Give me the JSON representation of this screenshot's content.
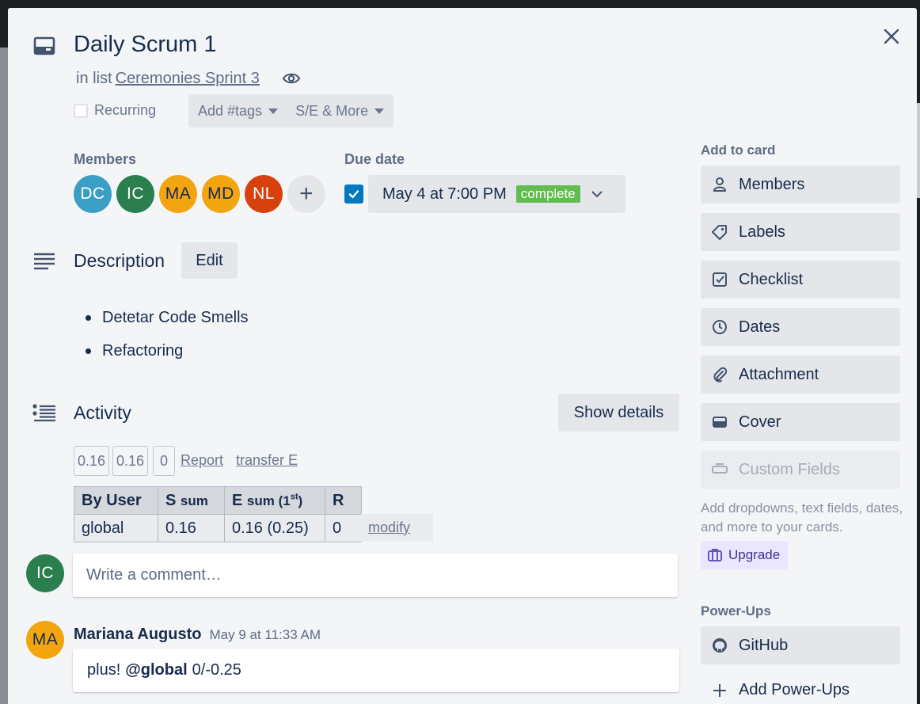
{
  "card": {
    "title": "Daily Scrum 1",
    "in_list_prefix": "in list",
    "list_name": "Ceremonies Sprint 3",
    "recurring_label": "Recurring",
    "tags_label": "Add #tags",
    "se_more_label": "S/E & More"
  },
  "members": {
    "label": "Members",
    "avatars": [
      {
        "initials": "DC",
        "color": "#3a9fc5"
      },
      {
        "initials": "IC",
        "color": "#2b7f4f"
      },
      {
        "initials": "MA",
        "color": "#f2a50f"
      },
      {
        "initials": "MD",
        "color": "#f2a50f"
      },
      {
        "initials": "NL",
        "color": "#d6410d"
      }
    ],
    "add_symbol": "+"
  },
  "due_date": {
    "label": "Due date",
    "value": "May 4 at 7:00 PM",
    "status": "complete",
    "checked": true
  },
  "description": {
    "title": "Description",
    "edit_label": "Edit",
    "items": [
      "Detetar Code Smells",
      "Refactoring"
    ]
  },
  "activity": {
    "title": "Activity",
    "show_details_label": "Show details",
    "mini_values": [
      "0.16",
      "0.16",
      "0"
    ],
    "report_label": "Report",
    "transfer_label": "transfer E",
    "table": {
      "headers": [
        "By User",
        "S",
        "sum",
        "E",
        "sum (1",
        "st",
        ")",
        "R"
      ],
      "row": [
        "global",
        "0.16",
        "0.16 (0.25)",
        "0"
      ]
    },
    "modify_label": "modify",
    "comment_placeholder": "Write a comment…",
    "current_user_initials": "IC",
    "comment": {
      "author_initials": "MA",
      "author": "Mariana Augusto",
      "time": "May 9 at 11:33 AM",
      "text_before": "plus!",
      "mention": "@global",
      "text_after": "0/-0.25"
    }
  },
  "sidebar": {
    "add_to_card_title": "Add to card",
    "buttons": [
      "Members",
      "Labels",
      "Checklist",
      "Dates",
      "Attachment",
      "Cover",
      "Custom Fields"
    ],
    "custom_fields_note": "Add dropdowns, text fields, dates, and more to your cards.",
    "upgrade_label": "Upgrade",
    "powerups_title": "Power-Ups",
    "github_label": "GitHub",
    "add_powerups_label": "Add Power-Ups"
  },
  "colors": {
    "accent_blue": "#0079bf",
    "complete_green": "#61bd4f",
    "modal_bg": "#f4f5f7",
    "button_bg": "#e4e6ea"
  }
}
